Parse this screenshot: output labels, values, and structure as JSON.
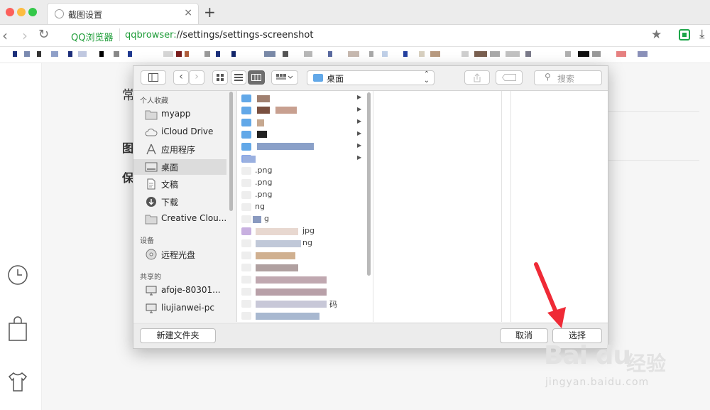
{
  "browser": {
    "tab_title": "截图设置",
    "tab_close": "×",
    "new_tab": "+",
    "brand": "QQ浏览器",
    "url_scheme": "qqbrowser:",
    "url_path": "//settings/settings-screenshot"
  },
  "page": {
    "frag_1": "常",
    "frag_2": "图",
    "frag_3": "保"
  },
  "dialog": {
    "location": "桌面",
    "search_placeholder": "搜索",
    "sidebar": {
      "favorites_header": "个人收藏",
      "favorites": [
        {
          "label": "myapp",
          "icon": "folder-icon"
        },
        {
          "label": "iCloud Drive",
          "icon": "cloud-icon"
        },
        {
          "label": "应用程序",
          "icon": "applications-icon"
        },
        {
          "label": "桌面",
          "icon": "desktop-icon"
        },
        {
          "label": "文稿",
          "icon": "document-icon"
        },
        {
          "label": "下载",
          "icon": "download-icon"
        },
        {
          "label": "Creative Clou...",
          "icon": "folder-icon"
        }
      ],
      "devices_header": "设备",
      "devices": [
        {
          "label": "远程光盘",
          "icon": "disc-icon"
        }
      ],
      "shared_header": "共享的",
      "shared": [
        {
          "label": "afoje-80301...",
          "icon": "monitor-icon"
        },
        {
          "label": "liujianwei-pc",
          "icon": "monitor-icon"
        }
      ]
    },
    "files": [
      {
        "label": "",
        "kind": "folder"
      },
      {
        "label": "",
        "kind": "folder"
      },
      {
        "label": "",
        "kind": "folder"
      },
      {
        "label": "",
        "kind": "folder"
      },
      {
        "label": "",
        "kind": "folder"
      },
      {
        "label": ".png",
        "kind": "file"
      },
      {
        "label": ".png",
        "kind": "file"
      },
      {
        "label": ".png",
        "kind": "file"
      },
      {
        "label": "ng",
        "kind": "file"
      },
      {
        "label": "g",
        "kind": "file"
      },
      {
        "label": "jpg",
        "kind": "file"
      },
      {
        "label": "ng",
        "kind": "file"
      },
      {
        "label": "",
        "kind": "file"
      },
      {
        "label": "",
        "kind": "file"
      },
      {
        "label": "",
        "kind": "file"
      },
      {
        "label": "",
        "kind": "file"
      },
      {
        "label": "码",
        "kind": "file"
      },
      {
        "label": "",
        "kind": "file"
      }
    ],
    "new_folder_label": "新建文件夹",
    "cancel_label": "取消",
    "choose_label": "选择"
  },
  "watermark": {
    "big": "Bai du",
    "cn": "经验",
    "url": "jingyan.baidu.com"
  },
  "colors": {
    "accent_green": "#1e9c38",
    "folder_blue": "#62a8e8",
    "annotation_red": "#ef2a36"
  }
}
